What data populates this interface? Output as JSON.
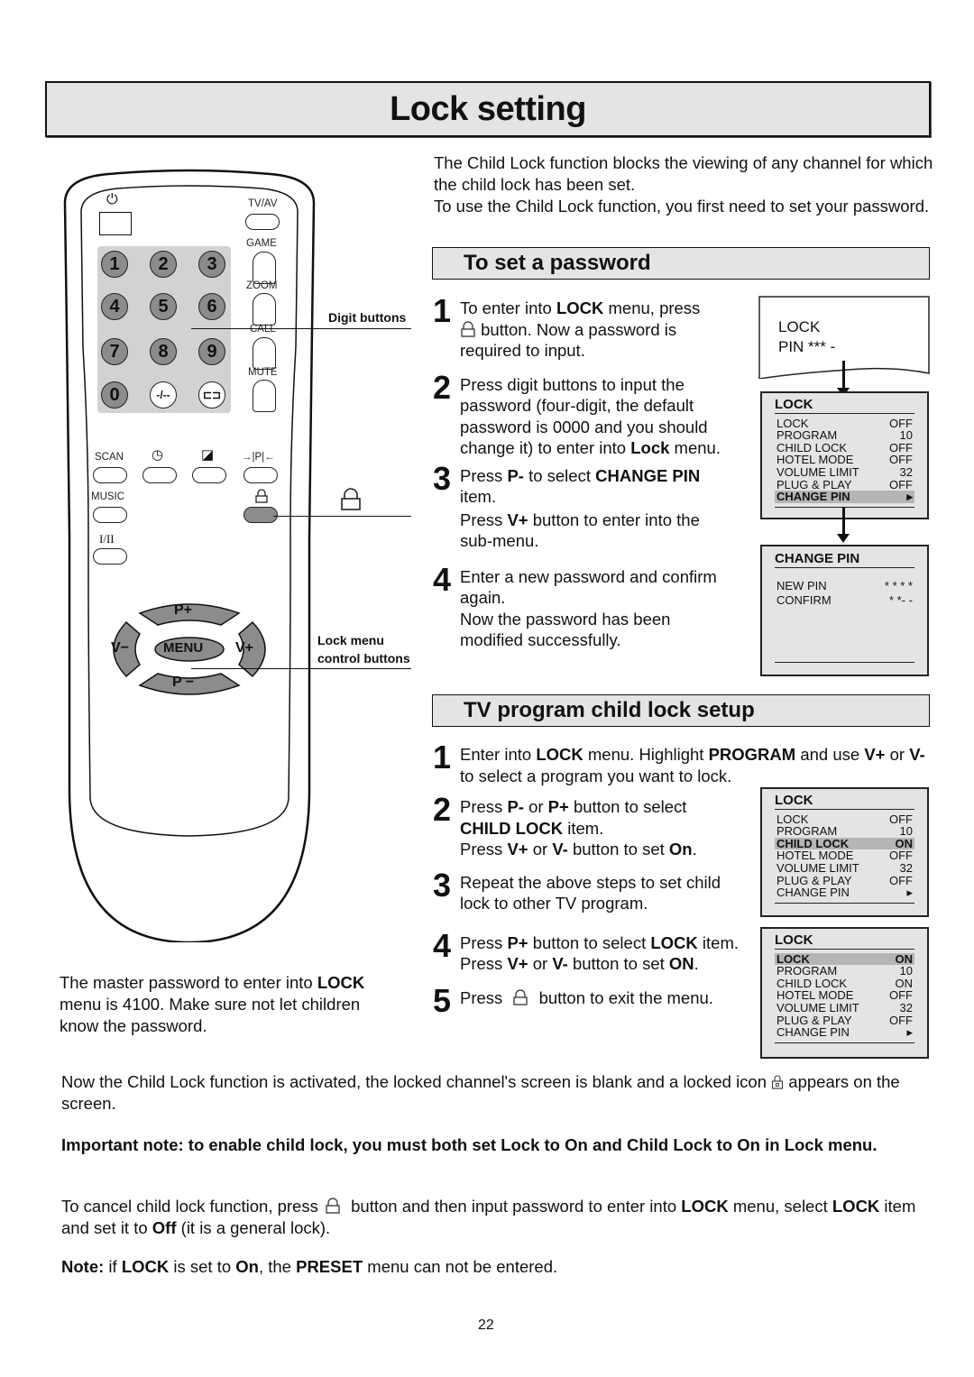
{
  "page": {
    "title": "Lock setting",
    "page_number": "22"
  },
  "intro": {
    "line1": "The Child Lock function blocks the viewing of any channel for which the child lock has been set.",
    "line2": "To use the Child Lock function, you first need to set your password."
  },
  "remote": {
    "top_labels": {
      "power": "⏻",
      "tv_av": "TV/AV",
      "game": "GAME",
      "zoom": "ZOOM",
      "call": "CALL",
      "mute": "MUTE"
    },
    "digits": [
      "1",
      "2",
      "3",
      "4",
      "5",
      "6",
      "7",
      "8",
      "9",
      "0"
    ],
    "special_keys": [
      "-/--",
      "⊏⊐"
    ],
    "row_labels": {
      "scan": "SCAN",
      "clock": "◷",
      "picture": "◪",
      "pp": "→|P|←",
      "music": "MUSIC",
      "lock": "lock",
      "stereo": "I/II"
    },
    "nav": {
      "p_plus": "P+",
      "p_minus": "P −",
      "v_minus": "V−",
      "v_plus": "V+",
      "menu": "MENU"
    },
    "callouts": {
      "digit_buttons": "Digit buttons",
      "lock_menu_1": "Lock menu",
      "lock_menu_2": "control buttons"
    },
    "lock_button_color": "#8c8c8c"
  },
  "master_note": {
    "pre": "The master password to enter into ",
    "bold": "LOCK",
    "post": " menu is 4100. Make sure not let children know the password."
  },
  "set_password": {
    "heading": "To set a password",
    "steps": [
      {
        "num": "1",
        "parts": [
          [
            "To enter into ",
            false
          ],
          [
            "LOCK",
            true
          ],
          [
            " menu, press ",
            false
          ]
        ],
        "parts2": " button. Now a password is required to input."
      },
      {
        "num": "2",
        "text": "Press digit buttons to input the password (four-digit, the default password is 0000 and you should change it) to enter into ",
        "bold_end": "Lock",
        "end": " menu."
      },
      {
        "num": "3",
        "a": "Press ",
        "b": "P-",
        "c": " to select ",
        "d": "CHANGE PIN",
        "e": " item.",
        "f": "Press ",
        "g": "V+",
        "h": " button to enter into the sub-menu."
      },
      {
        "num": "4",
        "a": "Enter a new password and confirm again.",
        "b": "Now the password has been modified successfully."
      }
    ],
    "pin_screen": {
      "line1": "LOCK",
      "line2": "PIN *** -"
    },
    "lock_menu": {
      "title": "LOCK",
      "rows": [
        {
          "label": "LOCK",
          "value": "OFF"
        },
        {
          "label": "PROGRAM",
          "value": "10"
        },
        {
          "label": "CHILD LOCK",
          "value": "OFF"
        },
        {
          "label": "HOTEL MODE",
          "value": "OFF"
        },
        {
          "label": "VOLUME LIMIT",
          "value": "32"
        },
        {
          "label": "PLUG & PLAY",
          "value": "OFF"
        },
        {
          "label": "CHANGE PIN",
          "value": "▸",
          "highlighted": true
        }
      ]
    },
    "change_pin_menu": {
      "title": "CHANGE PIN",
      "rows": [
        {
          "label": "NEW PIN",
          "value": "* * * *"
        },
        {
          "label": "CONFIRM",
          "value": "* *- -"
        }
      ]
    }
  },
  "child_lock": {
    "heading": "TV program child lock setup",
    "step1": {
      "a": "Enter into ",
      "b": "LOCK",
      "c": " menu. Highlight ",
      "d": "PROGRAM",
      "e": " and use ",
      "f": "V+",
      "g": " or ",
      "h": "V-",
      "i": " to select a program you want to lock."
    },
    "step2": {
      "a": "Press ",
      "b": "P-",
      "c": " or ",
      "d": "P+",
      "e": " button to select ",
      "f": "CHILD LOCK",
      "g": " item.",
      "h": "Press ",
      "i": "V+",
      "j": " or ",
      "k": "V-",
      "l": " button to set ",
      "m": "On",
      "n": "."
    },
    "step3": "Repeat the above steps to set child lock to other TV program.",
    "step4": {
      "a": "Press ",
      "b": "P+",
      "c": " button to select ",
      "d": "LOCK",
      "e": " item.",
      "f": "Press ",
      "g": "V+",
      "h": " or ",
      "i": "V-",
      "j": " button to set ",
      "k": "ON",
      "l": "."
    },
    "step5": {
      "a": "Press ",
      "b": " button to exit the menu."
    },
    "menu_a": {
      "title": "LOCK",
      "rows": [
        {
          "label": "LOCK",
          "value": "OFF"
        },
        {
          "label": "PROGRAM",
          "value": "10"
        },
        {
          "label": "CHILD LOCK",
          "value": "ON",
          "highlighted": true
        },
        {
          "label": "HOTEL MODE",
          "value": "OFF"
        },
        {
          "label": "VOLUME LIMIT",
          "value": "32"
        },
        {
          "label": "PLUG & PLAY",
          "value": "OFF"
        },
        {
          "label": "CHANGE PIN",
          "value": "▸"
        }
      ]
    },
    "menu_b": {
      "title": "LOCK",
      "rows": [
        {
          "label": "LOCK",
          "value": "ON",
          "highlighted": true
        },
        {
          "label": "PROGRAM",
          "value": "10"
        },
        {
          "label": "CHILD LOCK",
          "value": "ON"
        },
        {
          "label": "HOTEL MODE",
          "value": "OFF"
        },
        {
          "label": "VOLUME LIMIT",
          "value": "32"
        },
        {
          "label": "PLUG & PLAY",
          "value": "OFF"
        },
        {
          "label": "CHANGE PIN",
          "value": "▸"
        }
      ]
    }
  },
  "footer": {
    "activated_a": "Now the Child Lock function is activated, the locked channel's screen is blank and a locked icon ",
    "activated_b": " appears on the screen.",
    "important": "Important note: to enable child lock, you must both set Lock to On and Child Lock to On in Lock menu.",
    "cancel": {
      "a": "To cancel child lock function, press ",
      "b": " button and then input password to enter into ",
      "c": "LOCK",
      "d": " menu, select ",
      "e": "LOCK",
      "f": " item and set it to ",
      "g": "Off",
      "h": " (it is a general lock)."
    },
    "note": {
      "a": "Note:",
      "b": " if ",
      "c": "LOCK",
      "d": " is set to ",
      "e": "On",
      "f": ", the ",
      "g": "PRESET",
      "h": " menu can not be entered."
    }
  }
}
